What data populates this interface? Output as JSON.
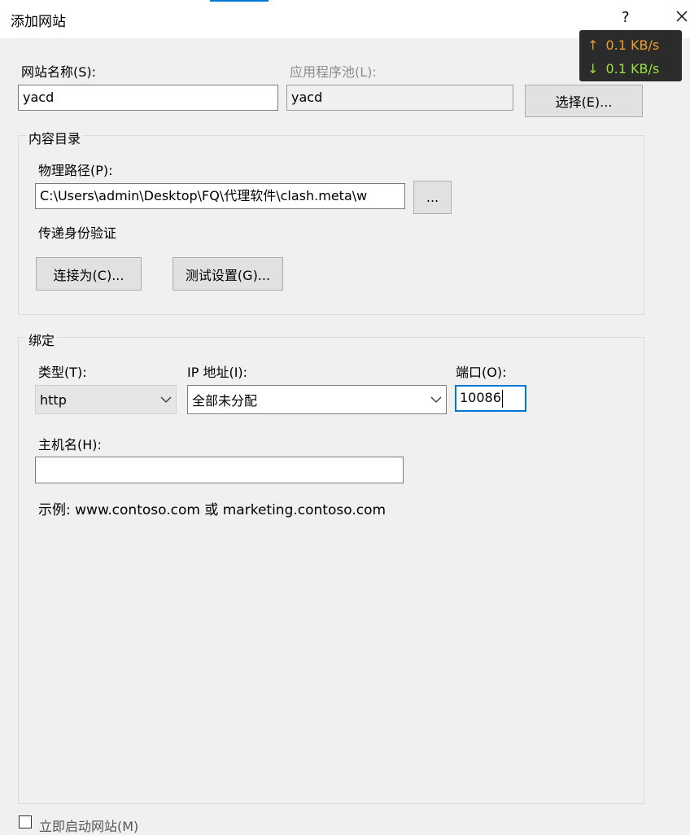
{
  "window": {
    "title": "添加网站",
    "help_label": "?",
    "close_icon": "close-icon"
  },
  "site": {
    "name_label": "网站名称(S):",
    "name_value": "yacd",
    "pool_label": "应用程序池(L):",
    "pool_value": "yacd",
    "select_button": "选择(E)..."
  },
  "content_dir": {
    "legend": "内容目录",
    "path_label": "物理路径(P):",
    "path_value": "C:\\Users\\admin\\Desktop\\FQ\\代理软件\\clash.meta\\w",
    "browse_button": "...",
    "passthrough_label": "传递身份验证",
    "connect_as_button": "连接为(C)...",
    "test_settings_button": "测试设置(G)..."
  },
  "binding": {
    "legend": "绑定",
    "type_label": "类型(T):",
    "type_value": "http",
    "ip_label": "IP 地址(I):",
    "ip_value": "全部未分配",
    "port_label": "端口(O):",
    "port_value": "10086",
    "host_label": "主机名(H):",
    "host_value": "",
    "example_text": "示例: www.contoso.com 或 marketing.contoso.com"
  },
  "net_monitor": {
    "up_arrow": "↑",
    "up_value": "0.1 KB/s",
    "up_color": "#f0a030",
    "down_arrow": "↓",
    "down_value": "0.1 KB/s",
    "down_color": "#9be23c"
  },
  "start_checkbox_label": "立即启动网站(M)"
}
